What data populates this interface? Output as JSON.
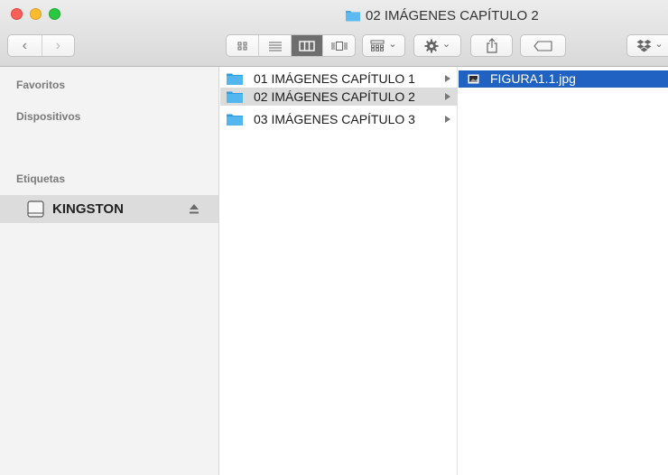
{
  "window": {
    "title": "02 IMÁGENES CAPÍTULO 2"
  },
  "toolbar": {
    "back_icon": "‹",
    "forward_icon": "›",
    "dropdown_glyph": "⌄"
  },
  "sidebar": {
    "favorites_heading": "Favoritos",
    "devices_heading": "Dispositivos",
    "devices": [
      {
        "label": "KINGSTON",
        "selected": true
      }
    ],
    "tags_heading": "Etiquetas"
  },
  "columns": {
    "folders": [
      {
        "label": "01 IMÁGENES CAPÍTULO 1",
        "selected": false
      },
      {
        "label": "02 IMÁGENES CAPÍTULO 2",
        "selected": true
      },
      {
        "label": "03 IMÁGENES CAPÍTULO 3",
        "selected": false
      }
    ],
    "files": [
      {
        "label": "FIGURA1.1.jpg",
        "selected": true
      }
    ]
  },
  "colors": {
    "folder_blue": "#41a9e6",
    "selection_blue": "#1f62c2",
    "selection_gray": "#dcdcdc",
    "sidebar_bg": "#f3f3f3"
  }
}
